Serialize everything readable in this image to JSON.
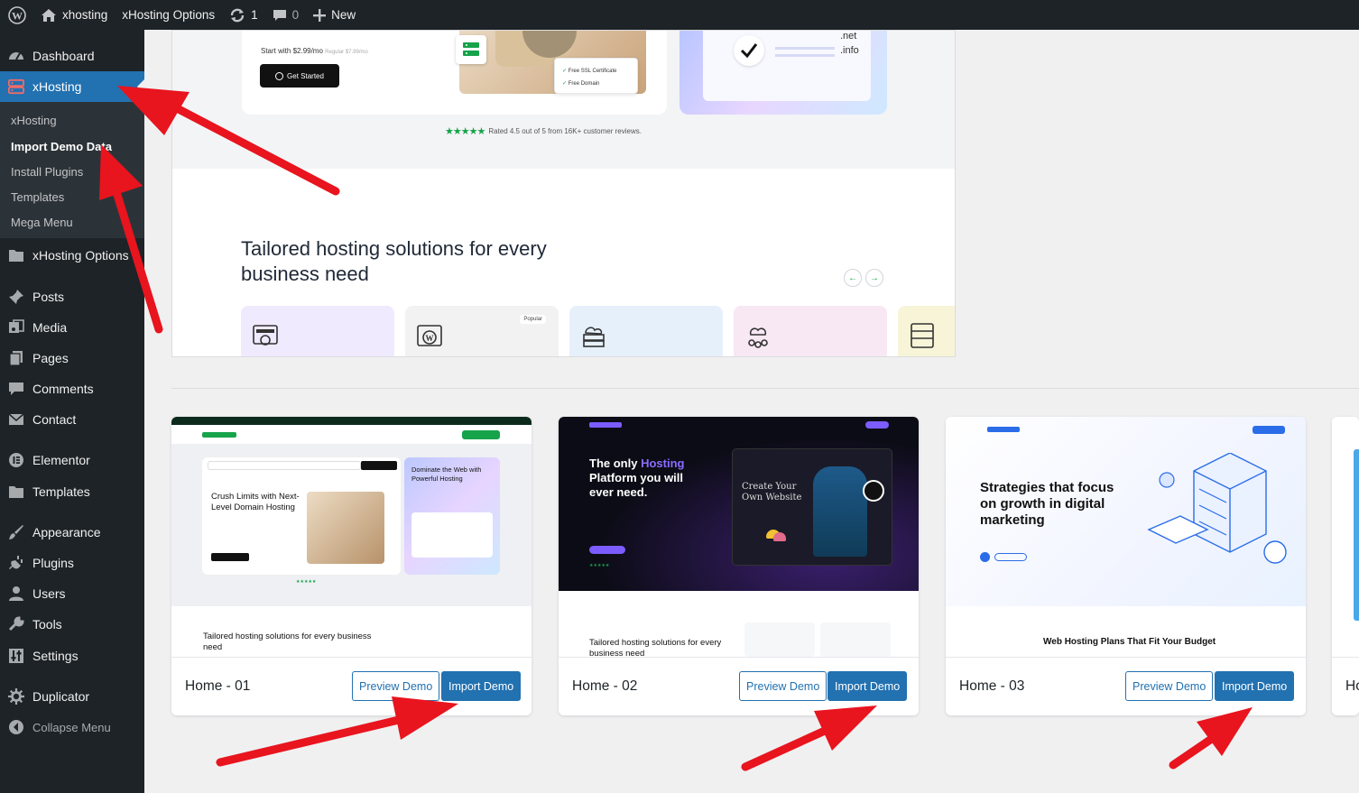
{
  "admin_bar": {
    "site_name": "xhosting",
    "options_link": "xHosting Options",
    "updates_count": "1",
    "comments_count": "0",
    "new_label": "New"
  },
  "sidebar": {
    "items": [
      {
        "label": "Dashboard",
        "icon": "dashboard-icon"
      },
      {
        "label": "xHosting",
        "icon": "server-icon",
        "active": true
      },
      {
        "label": "xHosting Options",
        "icon": "folder-icon"
      },
      {
        "label": "Posts",
        "icon": "pin-icon"
      },
      {
        "label": "Media",
        "icon": "media-icon"
      },
      {
        "label": "Pages",
        "icon": "pages-icon"
      },
      {
        "label": "Comments",
        "icon": "comment-icon"
      },
      {
        "label": "Contact",
        "icon": "mail-icon"
      },
      {
        "label": "Elementor",
        "icon": "elementor-icon"
      },
      {
        "label": "Templates",
        "icon": "folder-icon"
      },
      {
        "label": "Appearance",
        "icon": "brush-icon"
      },
      {
        "label": "Plugins",
        "icon": "plug-icon"
      },
      {
        "label": "Users",
        "icon": "user-icon"
      },
      {
        "label": "Tools",
        "icon": "wrench-icon"
      },
      {
        "label": "Settings",
        "icon": "settings-icon"
      },
      {
        "label": "Duplicator",
        "icon": "duplicator-icon"
      },
      {
        "label": "Collapse Menu",
        "icon": "collapse-icon"
      }
    ],
    "submenu": [
      {
        "label": "xHosting"
      },
      {
        "label": "Import Demo Data",
        "current": true
      },
      {
        "label": "Install Plugins"
      },
      {
        "label": "Templates"
      },
      {
        "label": "Mega Menu"
      }
    ]
  },
  "preview": {
    "start_text": "Start with $2.99/mo",
    "regular_text": "Regular $7.99/mo",
    "cta": "Get Started",
    "ssl_text": "Free SSL Certificate",
    "domain_text": "Free Domain",
    "tld_1": ".net",
    "tld_2": ".info",
    "rating_text": "Rated 4.5 out of 5 from 16K+ customer reviews.",
    "section_title": "Tailored hosting solutions for every business need",
    "popular_badge": "Popular"
  },
  "demos": [
    {
      "title": "Home - 01",
      "preview_label": "Preview Demo",
      "import_label": "Import Demo",
      "thumb_headline": "Crush Limits with Next-Level Domain Hosting",
      "thumb_side": "Dominate the Web with Powerful Hosting",
      "thumb_section": "Tailored hosting solutions for every business need"
    },
    {
      "title": "Home - 02",
      "preview_label": "Preview Demo",
      "import_label": "Import Demo",
      "thumb_headline_1": "The only",
      "thumb_headline_2": "Hosting",
      "thumb_headline_3": "Platform you will ever need.",
      "thumb_handwritten": "Create Your Own Website",
      "thumb_section": "Tailored hosting solutions for every business need"
    },
    {
      "title": "Home - 03",
      "preview_label": "Preview Demo",
      "import_label": "Import Demo",
      "thumb_headline": "Strategies that focus on growth in digital marketing",
      "thumb_section": "Web Hosting Plans That Fit Your Budget"
    },
    {
      "title": "Ho"
    }
  ],
  "colors": {
    "admin_dark": "#1d2327",
    "wp_blue": "#2271b1",
    "annotation_red": "#e8141e",
    "brand_green": "#16a34a"
  }
}
